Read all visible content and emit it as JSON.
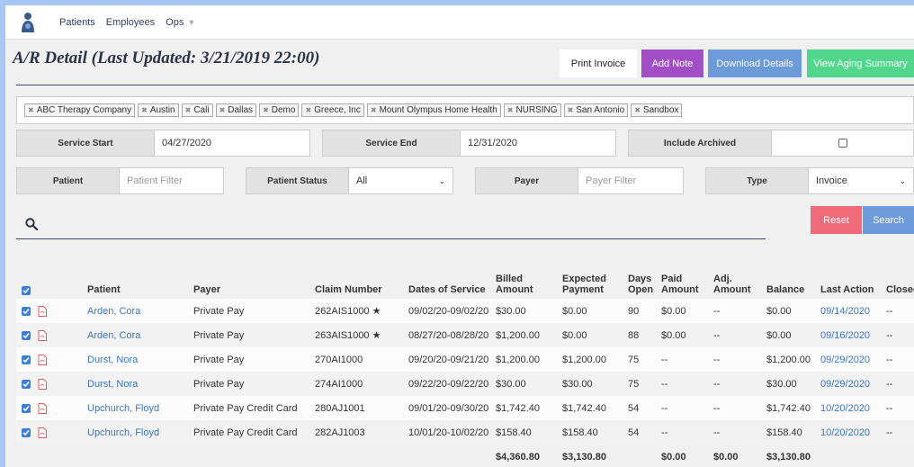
{
  "nav": {
    "items": [
      "Patients",
      "Employees",
      "Ops"
    ]
  },
  "page": {
    "title": "A/R Detail (Last Updated: 3/21/2019 22:00)"
  },
  "actions": {
    "print": "Print Invoice",
    "note": "Add Note",
    "download": "Download Details",
    "aging": "View Aging Summary"
  },
  "tags": [
    "ABC Therapy Company",
    "Austin",
    "Cali",
    "Dallas",
    "Demo",
    "Greece, Inc",
    "Mount Olympus Home Health",
    "NURSING",
    "San Antonio",
    "Sandbox"
  ],
  "filters": {
    "service_start_label": "Service Start",
    "service_start_value": "04/27/2020",
    "service_end_label": "Service End",
    "service_end_value": "12/31/2020",
    "include_archived_label": "Include Archived",
    "patient_label": "Patient",
    "patient_placeholder": "Patient Filter",
    "patient_status_label": "Patient Status",
    "patient_status_value": "All",
    "payer_label": "Payer",
    "payer_placeholder": "Payer Filter",
    "type_label": "Type",
    "type_value": "Invoice"
  },
  "search_actions": {
    "reset": "Reset",
    "search": "Search"
  },
  "table": {
    "headers": {
      "patient": "Patient",
      "payer": "Payer",
      "claim": "Claim Number",
      "dates": "Dates of Service",
      "billed": "Billed Amount",
      "expected": "Expected Payment",
      "days": "Days Open",
      "paid": "Paid Amount",
      "adj": "Adj. Amount",
      "balance": "Balance",
      "last_action": "Last Action",
      "closed": "Closed"
    },
    "rows": [
      {
        "patient": "Arden, Cora",
        "payer": "Private Pay",
        "claim": "262AIS1000",
        "star": "★",
        "dates": "09/02/20-09/02/20",
        "billed": "$30.00",
        "expected": "$0.00",
        "days": "90",
        "paid": "$0.00",
        "adj": "--",
        "balance": "$0.00",
        "last_action": "09/14/2020",
        "closed": "--"
      },
      {
        "patient": "Arden, Cora",
        "payer": "Private Pay",
        "claim": "263AIS1000",
        "star": "★",
        "dates": "08/27/20-08/28/20",
        "billed": "$1,200.00",
        "expected": "$0.00",
        "days": "88",
        "paid": "$0.00",
        "adj": "--",
        "balance": "$0.00",
        "last_action": "09/16/2020",
        "closed": "--"
      },
      {
        "patient": "Durst, Nora",
        "payer": "Private Pay",
        "claim": "270AI1000",
        "star": "",
        "dates": "09/20/20-09/21/20",
        "billed": "$1,200.00",
        "expected": "$1,200.00",
        "days": "75",
        "paid": "--",
        "adj": "--",
        "balance": "$1,200.00",
        "last_action": "09/29/2020",
        "closed": "--"
      },
      {
        "patient": "Durst, Nora",
        "payer": "Private Pay",
        "claim": "274AI1000",
        "star": "",
        "dates": "09/22/20-09/22/20",
        "billed": "$30.00",
        "expected": "$30.00",
        "days": "75",
        "paid": "--",
        "adj": "--",
        "balance": "$30.00",
        "last_action": "09/29/2020",
        "closed": "--"
      },
      {
        "patient": "Upchurch, Floyd",
        "payer": "Private Pay Credit Card",
        "claim": "280AJ1001",
        "star": "",
        "dates": "09/01/20-09/30/20",
        "billed": "$1,742.40",
        "expected": "$1,742.40",
        "days": "54",
        "paid": "--",
        "adj": "--",
        "balance": "$1,742.40",
        "last_action": "10/20/2020",
        "closed": "--"
      },
      {
        "patient": "Upchurch, Floyd",
        "payer": "Private Pay Credit Card",
        "claim": "282AJ1003",
        "star": "",
        "dates": "10/01/20-10/02/20",
        "billed": "$158.40",
        "expected": "$158.40",
        "days": "54",
        "paid": "--",
        "adj": "--",
        "balance": "$158.40",
        "last_action": "10/20/2020",
        "closed": "--"
      }
    ],
    "totals": {
      "billed": "$4,360.80",
      "expected": "$3,130.80",
      "paid": "$0.00",
      "adj": "$0.00",
      "balance": "$3,130.80"
    }
  }
}
